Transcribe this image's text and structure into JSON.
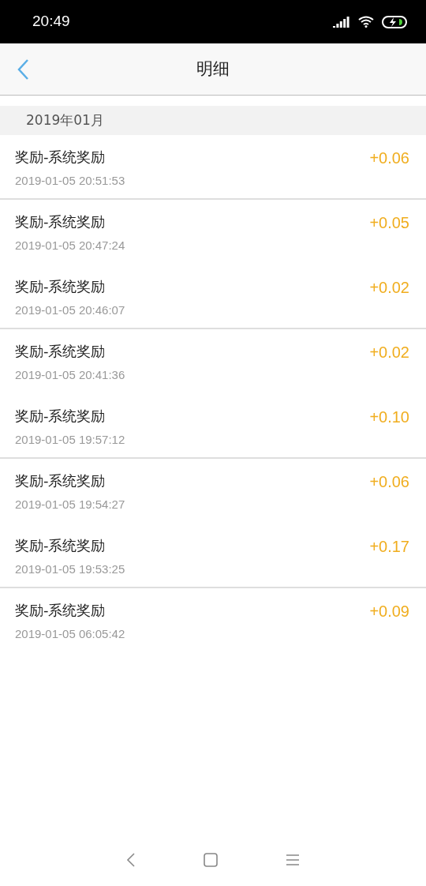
{
  "status_bar": {
    "time": "20:49",
    "battery_charging": true
  },
  "header": {
    "title": "明细"
  },
  "section": {
    "title": "2019年01月"
  },
  "records": [
    {
      "title": "奖励-系统奖励",
      "time": "2019-01-05 20:51:53",
      "amount": "+0.06",
      "divider_below": true
    },
    {
      "title": "奖励-系统奖励",
      "time": "2019-01-05 20:47:24",
      "amount": "+0.05",
      "divider_below": false
    },
    {
      "title": "奖励-系统奖励",
      "time": "2019-01-05 20:46:07",
      "amount": "+0.02",
      "divider_below": true
    },
    {
      "title": "奖励-系统奖励",
      "time": "2019-01-05 20:41:36",
      "amount": "+0.02",
      "divider_below": false
    },
    {
      "title": "奖励-系统奖励",
      "time": "2019-01-05 19:57:12",
      "amount": "+0.10",
      "divider_below": true
    },
    {
      "title": "奖励-系统奖励",
      "time": "2019-01-05 19:54:27",
      "amount": "+0.06",
      "divider_below": false
    },
    {
      "title": "奖励-系统奖励",
      "time": "2019-01-05 19:53:25",
      "amount": "+0.17",
      "divider_below": true
    },
    {
      "title": "奖励-系统奖励",
      "time": "2019-01-05 06:05:42",
      "amount": "+0.09",
      "divider_below": false
    }
  ]
}
